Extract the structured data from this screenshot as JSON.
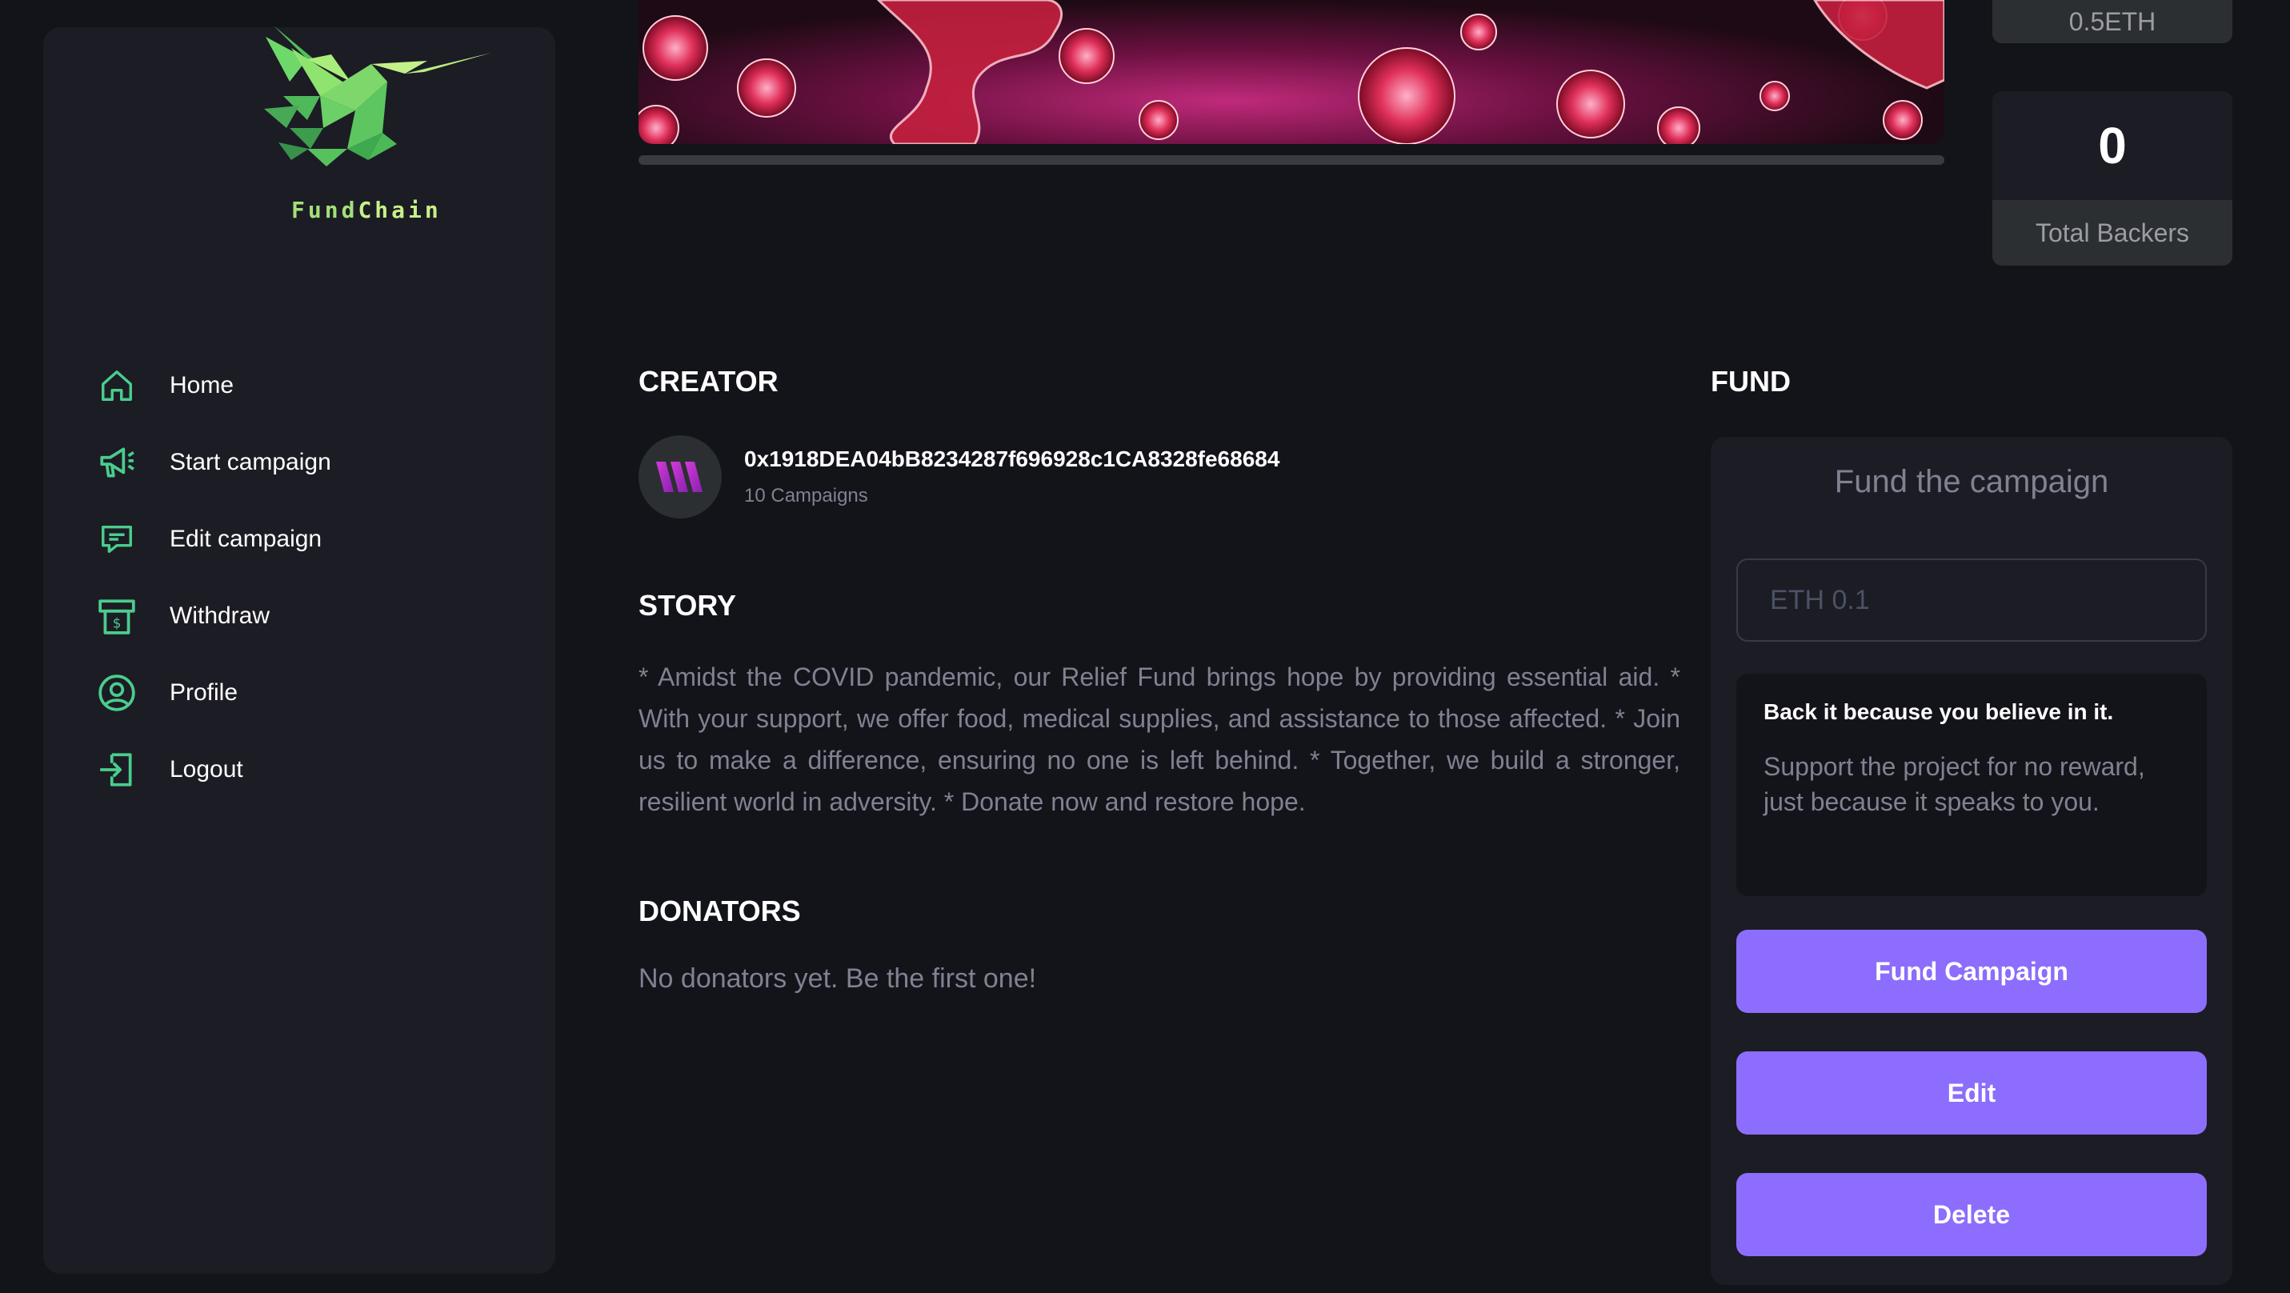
{
  "app": {
    "brand_prefix": "Fund",
    "brand_suffix": "Chain"
  },
  "sidebar": {
    "items": [
      {
        "label": "Home",
        "icon": "home-icon"
      },
      {
        "label": "Start campaign",
        "icon": "megaphone-icon"
      },
      {
        "label": "Edit campaign",
        "icon": "message-icon"
      },
      {
        "label": "Withdraw",
        "icon": "withdraw-icon"
      },
      {
        "label": "Profile",
        "icon": "profile-icon"
      },
      {
        "label": "Logout",
        "icon": "logout-icon"
      }
    ]
  },
  "campaign": {
    "progress_fraction": 0,
    "stats": {
      "target_label": "0.5ETH",
      "backers_value": "0",
      "backers_label": "Total Backers"
    }
  },
  "creator": {
    "heading": "CREATOR",
    "address": "0x1918DEA04bB8234287f696928c1CA8328fe68684",
    "campaigns": "10 Campaigns"
  },
  "story": {
    "heading": "STORY",
    "text": "* Amidst the COVID pandemic, our Relief Fund brings hope by providing essential aid. * With your support, we offer food, medical supplies, and assistance to those affected. * Join us to make a difference, ensuring no one is left behind. * Together, we build a stronger, resilient world in adversity. * Donate now and restore hope."
  },
  "donators": {
    "heading": "DONATORS",
    "empty_text": "No donators yet. Be the first one!"
  },
  "fund": {
    "heading": "FUND",
    "panel_title": "Fund the campaign",
    "input_placeholder": "ETH 0.1",
    "note_title": "Back it because you believe in it.",
    "note_body": "Support the project for no reward, just because it speaks to you.",
    "fund_button": "Fund Campaign",
    "edit_button": "Edit",
    "delete_button": "Delete"
  },
  "colors": {
    "background": "#13131a",
    "card": "#1c1c24",
    "accent_purple": "#8c6dfd",
    "accent_green": "#4acd8d",
    "muted_text": "#808191"
  }
}
